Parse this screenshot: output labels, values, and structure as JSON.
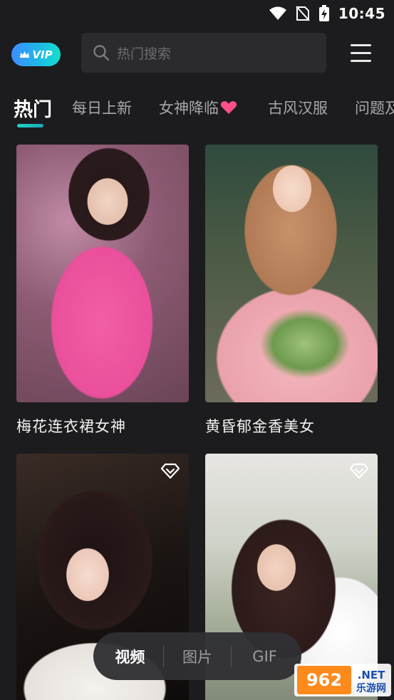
{
  "status_bar": {
    "time": "10:45",
    "icons": [
      "wifi-icon",
      "no-sim-icon",
      "battery-charging-icon"
    ]
  },
  "header": {
    "vip_label": "VIP",
    "search_placeholder": "热门搜索"
  },
  "tabs": [
    {
      "label": "热门",
      "active": true
    },
    {
      "label": "每日上新",
      "active": false
    },
    {
      "label": "女神降临",
      "active": false
    },
    {
      "label": "古风汉服",
      "active": false
    },
    {
      "label": "问题及",
      "active": false
    }
  ],
  "cards": [
    {
      "title": "梅花连衣裙女神",
      "icon": ""
    },
    {
      "title": "黄昏郁金香美女",
      "icon": ""
    },
    {
      "title": "",
      "icon": "diamond-icon"
    },
    {
      "title": "",
      "icon": "diamond-icon"
    }
  ],
  "bottom_switch": [
    {
      "label": "视频",
      "active": true
    },
    {
      "label": "图片",
      "active": false
    },
    {
      "label": "GIF",
      "active": false
    }
  ],
  "watermark": {
    "top_text": "962.NET",
    "bottom_text": "乐游网"
  },
  "colors": {
    "accent": "#22d3c5",
    "heart": "#ff4f8b",
    "vip_start": "#3c8dff",
    "vip_end": "#12e0c9"
  }
}
